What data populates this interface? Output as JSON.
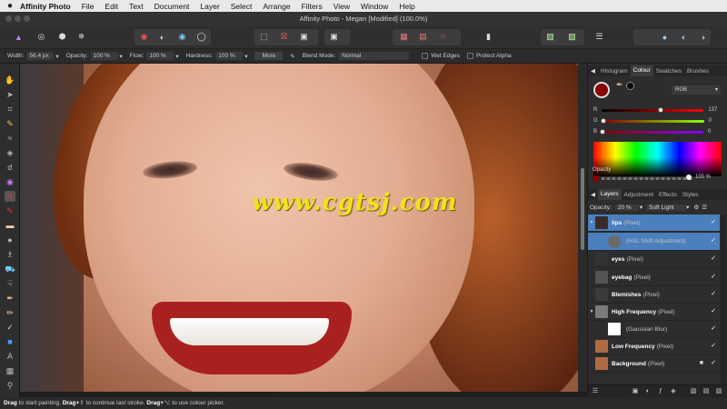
{
  "menubar": {
    "apple": "",
    "app_name": "Affinity Photo",
    "items": [
      "File",
      "Edit",
      "Text",
      "Document",
      "Layer",
      "Select",
      "Arrange",
      "Filters",
      "View",
      "Window",
      "Help"
    ]
  },
  "window": {
    "title": "Affinity Photo - Megan [Modified] (100.0%)"
  },
  "context_toolbar": {
    "width_label": "Width:",
    "width_value": "56.4 px",
    "opacity_label": "Opacity:",
    "opacity_value": "100 %",
    "flow_label": "Flow:",
    "flow_value": "100 %",
    "hardness_label": "Hardness:",
    "hardness_value": "100 %",
    "more_label": "More",
    "blend_label": "Blend Mode:",
    "blend_value": "Normal",
    "wet_edges_label": "Wet Edges",
    "protect_alpha_label": "Protect Alpha"
  },
  "canvas": {
    "watermark": "www.cgtsj.com"
  },
  "colour_panel": {
    "tabs": [
      "Histogram",
      "Colour",
      "Swatches",
      "Brushes"
    ],
    "active_tab": "Colour",
    "mode": "RGB",
    "sliders": [
      {
        "label": "R",
        "value": "137",
        "fraction": 0.54
      },
      {
        "label": "G",
        "value": "0",
        "fraction": 0.0
      },
      {
        "label": "B",
        "value": "0",
        "fraction": 0.0
      }
    ],
    "opacity_label": "Opacity",
    "opacity_value": "100 %",
    "primary_colour": "#890000",
    "secondary_colour": "#000000"
  },
  "layers_panel": {
    "tabs": [
      "Layers",
      "Adjustment",
      "Effects",
      "Styles"
    ],
    "active_tab": "Layers",
    "opacity_label": "Opacity:",
    "opacity_value": "20 %",
    "blend_value": "Soft Light",
    "layers": [
      {
        "name": "lips",
        "type": "(Pixel)",
        "selected": true,
        "checked": "✓"
      },
      {
        "name": "",
        "type": "(HSL Shift Adjustment)",
        "selected": true,
        "checked": "✓"
      },
      {
        "name": "eyes",
        "type": "(Pixel)",
        "selected": false,
        "checked": "✓"
      },
      {
        "name": "eyebag",
        "type": "(Pixel)",
        "selected": false,
        "checked": "✓"
      },
      {
        "name": "Blemishes",
        "type": "(Pixel)",
        "selected": false,
        "checked": "✓"
      },
      {
        "name": "High Frequency",
        "type": "(Pixel)",
        "selected": false,
        "checked": "✓"
      },
      {
        "name": "",
        "type": "(Gaussian Blur)",
        "selected": false,
        "checked": "✓"
      },
      {
        "name": "Low Frequency",
        "type": "(Pixel)",
        "selected": false,
        "checked": "✓"
      },
      {
        "name": "Background",
        "type": "(Pixel)",
        "selected": false,
        "checked": "✓"
      }
    ]
  },
  "status": {
    "drag1": "Drag",
    "text1": " to start painting. ",
    "drag2": "Drag+",
    "text2": " to continue last stroke. ",
    "drag3": "Drag+",
    "text3": " to use colour picker."
  },
  "colors": {
    "selected_layer": "#4b7fbd",
    "panel_bg": "#2d2d2d"
  }
}
